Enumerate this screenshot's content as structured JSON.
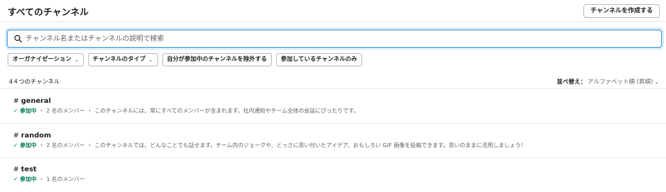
{
  "header": {
    "title": "すべてのチャンネル",
    "create_button": "チャンネルを作成する"
  },
  "search": {
    "placeholder": "チャンネル名またはチャンネルの説明で検索",
    "value": "",
    "icon": "search-icon"
  },
  "filters": [
    {
      "label": "オーガナイゼーション",
      "dropdown": true
    },
    {
      "label": "チャンネルのタイプ",
      "dropdown": true
    },
    {
      "label": "自分が参加中のチャンネルを除外する",
      "dropdown": false
    },
    {
      "label": "参加しているチャンネルのみ",
      "dropdown": false
    }
  ],
  "list": {
    "count": "4４つのチャンネル",
    "sort_label": "並べ替え：",
    "sort_value": "アルファベット順 (昇順)"
  },
  "channels": [
    {
      "hash": "#",
      "name": "general",
      "joined": "参加中",
      "members": "2 名のメンバー",
      "description": "このチャンネルには、常にすべてのメンバーが含まれます。社内通知やチーム全体の会話にぴったりです。"
    },
    {
      "hash": "#",
      "name": "random",
      "joined": "参加中",
      "members": "2 名のメンバー",
      "description": "このチャンネルでは、どんなことでも話せます。チーム内のジョークや、とっさに思い付いたアイデア、おもしろい GIF 画像を投稿できます。思いのままに活用しましょう！"
    },
    {
      "hash": "#",
      "name": "test",
      "joined": "参加中",
      "members": "1 名のメンバー",
      "description": ""
    }
  ],
  "colors": {
    "accent": "#3a8bd6",
    "joined": "#007a5a"
  }
}
